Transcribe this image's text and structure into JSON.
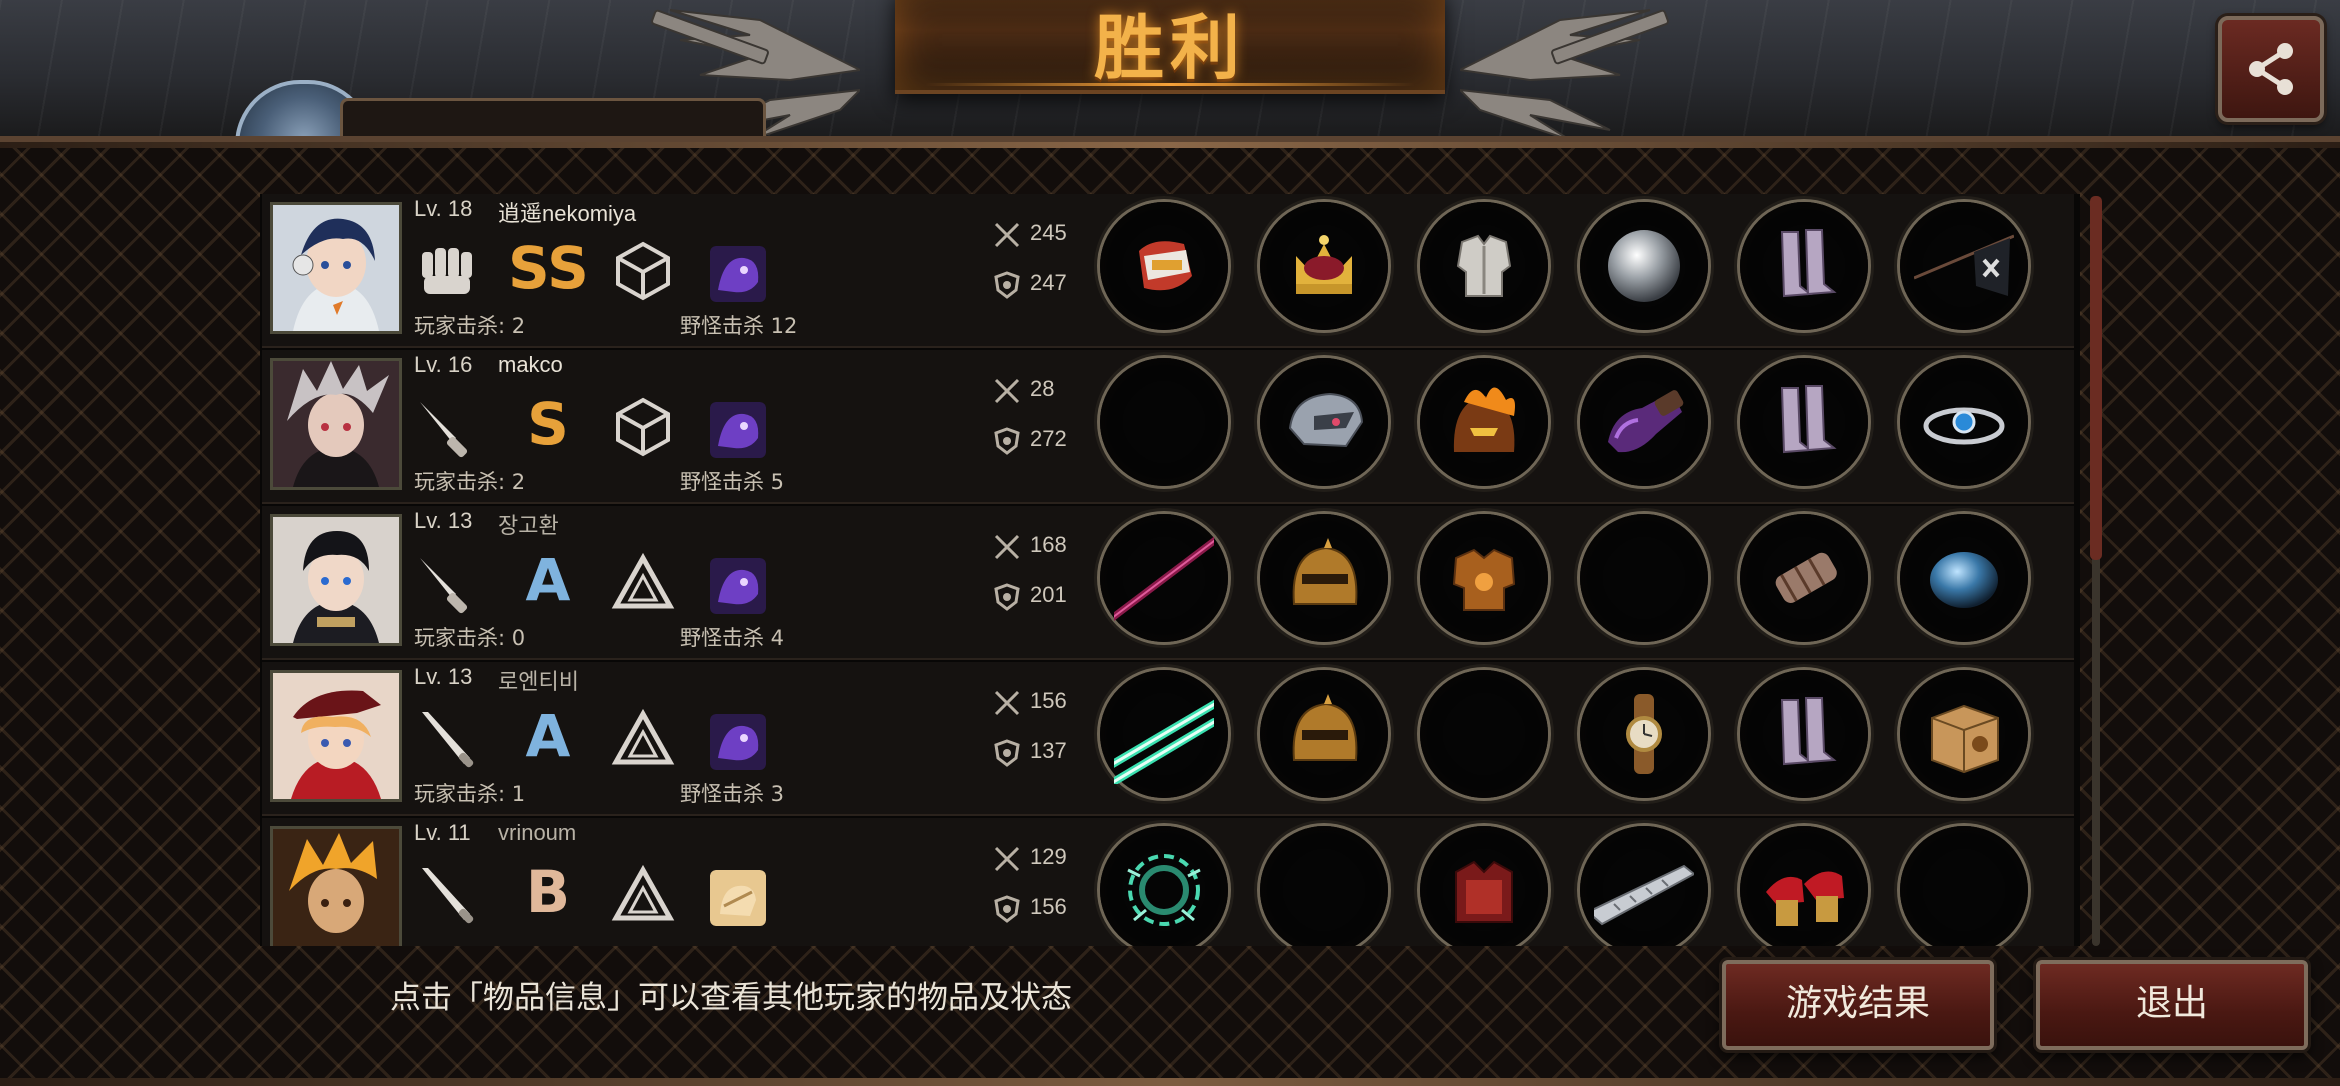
{
  "header": {
    "title": "胜利",
    "peek_name": "逍遥nekomiya"
  },
  "players": [
    {
      "level": "Lv. 18",
      "name": "逍遥nekomiya",
      "weapon_icon": "fist-icon",
      "grade": "SS",
      "grade_color": "#e7a13a",
      "class_icon": "cube-class-icon",
      "pet_icon": "purple-pet-icon",
      "player_kills": "玩家击杀: 2",
      "monster_kills": "野怪击杀 12",
      "attack": "245",
      "defense": "247",
      "items": [
        "gauntlet-icon",
        "crown-icon",
        "plate-armor-icon",
        "silver-disc-icon",
        "boots-icon",
        "flag-icon"
      ]
    },
    {
      "level": "Lv. 16",
      "name": "makco",
      "weapon_icon": "knife-icon",
      "grade": "S",
      "grade_color": "#e7a13a",
      "class_icon": "cube-class-icon",
      "pet_icon": "purple-pet-icon",
      "player_kills": "玩家击杀: 2",
      "monster_kills": "野怪击杀 5",
      "attack": "28",
      "defense": "272",
      "items": [
        "empty",
        "mech-helmet-icon",
        "flame-helmet-icon",
        "purple-glove-icon",
        "boots-icon",
        "blue-bracelet-icon"
      ]
    },
    {
      "level": "Lv. 13",
      "name": "장고환",
      "weapon_icon": "knife-icon",
      "grade": "A",
      "grade_color": "#7fb3de",
      "class_icon": "triangle-class-icon",
      "pet_icon": "purple-pet-icon",
      "player_kills": "玩家击杀: 0",
      "monster_kills": "野怪击杀 4",
      "attack": "168",
      "defense": "201",
      "items": [
        "crimson-sword-icon",
        "gold-helmet-icon",
        "bronze-armor-icon",
        "empty",
        "arm-guard-icon",
        "blue-orb-icon"
      ]
    },
    {
      "level": "Lv. 13",
      "name": "로엔티비",
      "weapon_icon": "bat-icon",
      "grade": "A",
      "grade_color": "#7fb3de",
      "class_icon": "triangle-class-icon",
      "pet_icon": "purple-pet-icon",
      "player_kills": "玩家击杀: 1",
      "monster_kills": "野怪击杀 3",
      "attack": "156",
      "defense": "137",
      "items": [
        "dual-lightsaber-icon",
        "gold-helmet-icon",
        "empty",
        "wristwatch-icon",
        "boots-icon",
        "cat-box-icon"
      ]
    },
    {
      "level": "Lv. 11",
      "name": "vrinoum",
      "weapon_icon": "bat-icon",
      "grade": "B",
      "grade_color": "#e0b89a",
      "class_icon": "triangle-class-icon",
      "pet_icon": "hand-pet-icon",
      "player_kills": "",
      "monster_kills": "",
      "attack": "129",
      "defense": "156",
      "items": [
        "thorn-ring-icon",
        "empty",
        "red-armor-icon",
        "steel-blade-icon",
        "red-heels-icon",
        "empty"
      ]
    }
  ],
  "footer": {
    "hint": "点击「物品信息」可以查看其他玩家的物品及状态",
    "result_button": "游戏结果",
    "exit_button": "退出"
  },
  "colors": {
    "title": "#f3b24a",
    "button": "#5a1f18",
    "panel_border": "#5b4331"
  }
}
